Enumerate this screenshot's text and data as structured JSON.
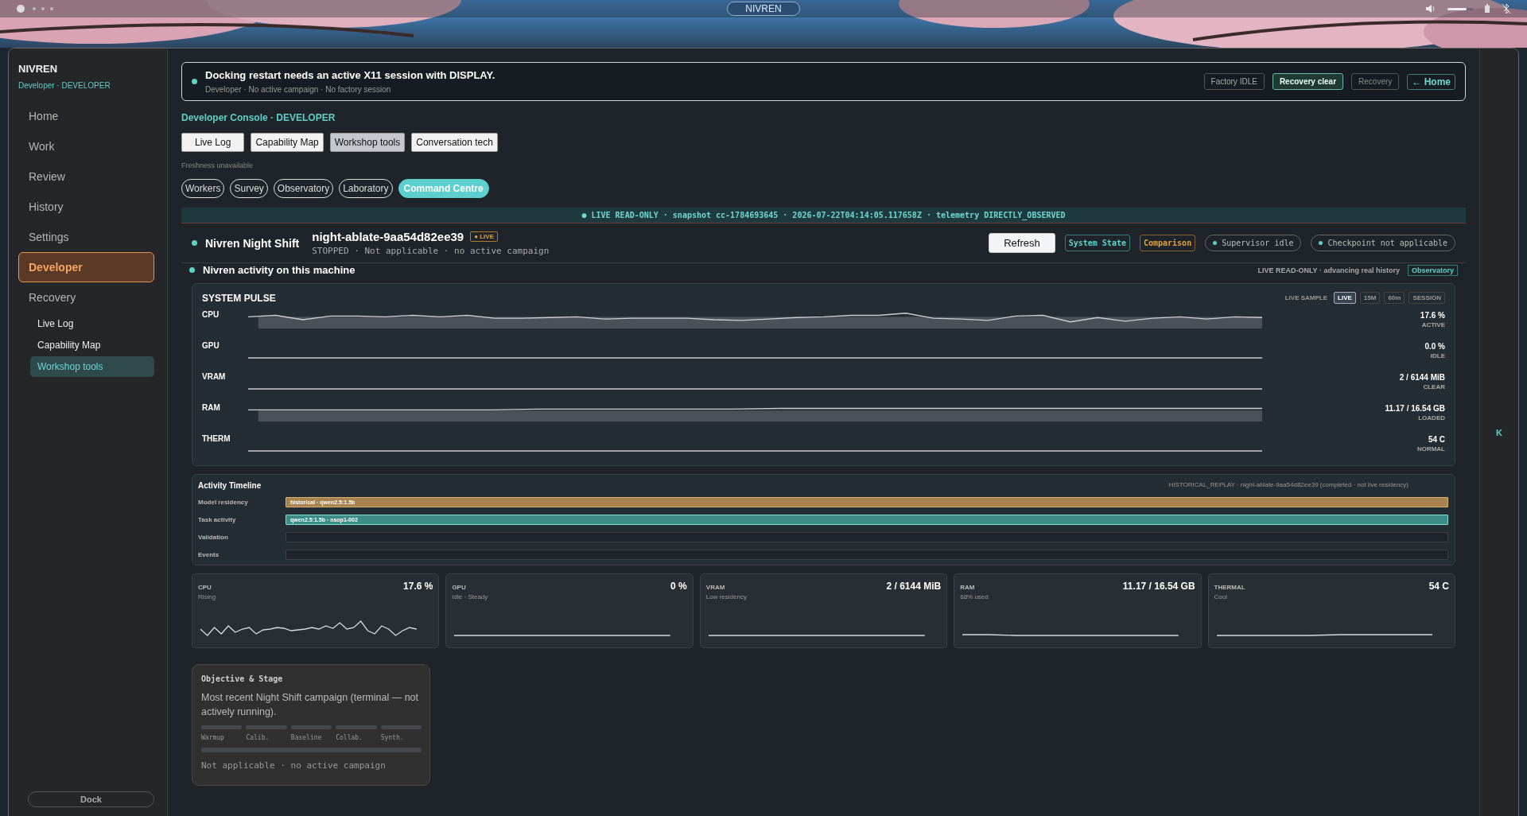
{
  "topbar": {
    "title": "NIVREN",
    "volume": {
      "level": 0.75
    }
  },
  "sidebar": {
    "app": "NIVREN",
    "role": "Developer · DEVELOPER",
    "items": [
      {
        "label": "Home",
        "selected": false
      },
      {
        "label": "Work",
        "selected": false
      },
      {
        "label": "Review",
        "selected": false
      },
      {
        "label": "History",
        "selected": false
      },
      {
        "label": "Settings",
        "selected": false
      },
      {
        "label": "Developer",
        "selected": true
      },
      {
        "label": "Recovery",
        "selected": false,
        "children": [
          {
            "label": "Live Log",
            "selected": false
          },
          {
            "label": "Capability Map",
            "selected": false
          },
          {
            "label": "Workshop tools",
            "selected": true
          }
        ]
      }
    ],
    "dock": "Dock"
  },
  "banner": {
    "title": "Docking restart needs an active X11 session with DISPLAY.",
    "subtitle": "Developer · No active campaign · No factory session",
    "chips": [
      {
        "label": "Factory IDLE",
        "kind": "muted"
      },
      {
        "label": "Recovery clear",
        "kind": "ok"
      },
      {
        "label": "Recovery",
        "kind": "dim"
      },
      {
        "label": "← Home",
        "kind": "link"
      }
    ]
  },
  "console_title": "Developer Console · DEVELOPER",
  "tools": [
    {
      "label": "Live Log",
      "selected": false
    },
    {
      "label": "Capability Map",
      "selected": false
    },
    {
      "label": "Workshop tools",
      "selected": true
    },
    {
      "label": "Conversation tech",
      "selected": false
    }
  ],
  "freshness": "Freshness unavailable",
  "views": [
    {
      "label": "Workers",
      "selected": false
    },
    {
      "label": "Survey",
      "selected": false
    },
    {
      "label": "Observatory",
      "selected": false
    },
    {
      "label": "Laboratory",
      "selected": false
    },
    {
      "label": "Command Centre",
      "selected": true
    }
  ],
  "telemetry": "● LIVE READ-ONLY · snapshot cc-1784693645 · 2026-07-22T04:14:05.117658Z · telemetry DIRECTLY_OBSERVED",
  "shift": {
    "name": "Nivren Night Shift",
    "run": "night-ablate-9aa54d82ee39",
    "badge": "● LIVE",
    "status": "STOPPED · Not applicable · no active campaign",
    "actions": [
      {
        "label": "Refresh",
        "kind": "button"
      },
      {
        "label": "System State",
        "kind": "teal"
      },
      {
        "label": "Comparison",
        "kind": "amber"
      },
      {
        "label": "Supervisor idle",
        "kind": "status"
      },
      {
        "label": "Checkpoint not applicable",
        "kind": "status"
      }
    ]
  },
  "activity": {
    "title": "Nivren activity on this machine",
    "note": "LIVE READ-ONLY · advancing real history",
    "link": "Observatory"
  },
  "pulse": {
    "title": "SYSTEM PULSE",
    "sample_label": "LIVE SAMPLE",
    "ranges": [
      {
        "label": "LIVE",
        "selected": true
      },
      {
        "label": "15M",
        "selected": false
      },
      {
        "label": "60m",
        "selected": false
      },
      {
        "label": "SESSION",
        "selected": false
      }
    ],
    "rows": [
      {
        "name": "CPU",
        "value": "17.6 %",
        "state": "ACTIVE"
      },
      {
        "name": "GPU",
        "value": "0.0 %",
        "state": "IDLE"
      },
      {
        "name": "VRAM",
        "value": "2 / 6144 MiB",
        "state": "CLEAR"
      },
      {
        "name": "RAM",
        "value": "11.17 / 16.54 GB",
        "state": "LOADED"
      },
      {
        "name": "THERM",
        "value": "54 C",
        "state": "NORMAL"
      }
    ]
  },
  "timeline": {
    "title": "Activity Timeline",
    "note": "HISTORICAL_REPLAY · night-ablate-9aa54d82ee39 (completed · not live residency)",
    "lanes": [
      {
        "name": "Model residency",
        "kind": "model",
        "label": "historical · qwen2.5:1.5b"
      },
      {
        "name": "Task activity",
        "kind": "task",
        "label": "qwen2.5:1.5b · nsop1-002"
      },
      {
        "name": "Validation",
        "kind": "empty"
      },
      {
        "name": "Events",
        "kind": "empty"
      }
    ]
  },
  "metrics": [
    {
      "name": "CPU",
      "value": "17.6 %",
      "note": "Rising"
    },
    {
      "name": "GPU",
      "value": "0 %",
      "note": "Idle · Steady"
    },
    {
      "name": "VRAM",
      "value": "2 / 6144 MiB",
      "note": "Low residency"
    },
    {
      "name": "RAM",
      "value": "11.17 / 16.54 GB",
      "note": "68% used"
    },
    {
      "name": "THERMAL",
      "value": "54 C",
      "note": "Cool"
    }
  ],
  "objective": {
    "title": "Objective & Stage",
    "text": "Most recent Night Shift campaign (terminal — not actively running).",
    "stages": [
      "Warmup",
      "Calib.",
      "Baseline",
      "Collab.",
      "Synth."
    ],
    "status": "Not applicable · no active campaign"
  },
  "right_rail": "K"
}
